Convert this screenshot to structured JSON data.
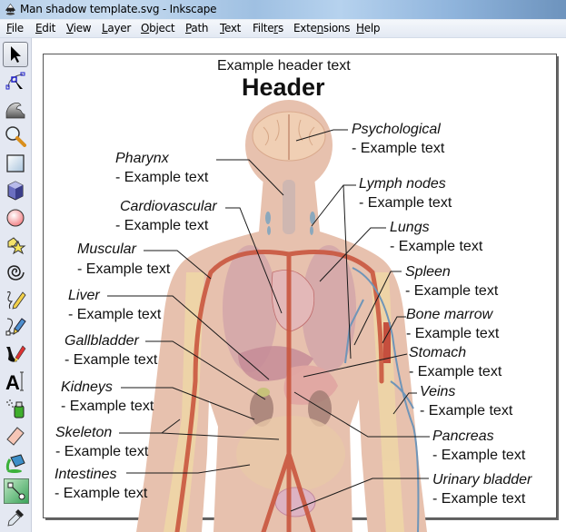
{
  "window": {
    "title": "Man shadow template.svg - Inkscape",
    "app_icon": "inkscape-logo-icon"
  },
  "menubar": {
    "items": [
      {
        "label": "File",
        "mnemonic": "F"
      },
      {
        "label": "Edit",
        "mnemonic": "E"
      },
      {
        "label": "View",
        "mnemonic": "V"
      },
      {
        "label": "Layer",
        "mnemonic": "L"
      },
      {
        "label": "Object",
        "mnemonic": "O"
      },
      {
        "label": "Path",
        "mnemonic": "P"
      },
      {
        "label": "Text",
        "mnemonic": "T"
      },
      {
        "label": "Filters",
        "mnemonic": "r"
      },
      {
        "label": "Extensions",
        "mnemonic": "n"
      },
      {
        "label": "Help",
        "mnemonic": "H"
      }
    ]
  },
  "toolbox": {
    "tools": [
      {
        "name": "selector-tool",
        "icon": "arrow-pointer-icon",
        "active": true
      },
      {
        "name": "node-tool",
        "icon": "node-edit-icon",
        "active": false
      },
      {
        "name": "tweak-tool",
        "icon": "tweak-wave-icon",
        "active": false
      },
      {
        "name": "zoom-tool",
        "icon": "magnifier-icon",
        "active": false
      },
      {
        "name": "rectangle-tool",
        "icon": "rectangle-icon",
        "active": false
      },
      {
        "name": "3d-box-tool",
        "icon": "cube-icon",
        "active": false
      },
      {
        "name": "ellipse-tool",
        "icon": "circle-icon",
        "active": false
      },
      {
        "name": "star-tool",
        "icon": "star-icon",
        "active": false
      },
      {
        "name": "spiral-tool",
        "icon": "spiral-icon",
        "active": false
      },
      {
        "name": "pencil-tool",
        "icon": "pencil-icon",
        "active": false
      },
      {
        "name": "pen-tool",
        "icon": "bezier-pen-icon",
        "active": false
      },
      {
        "name": "calligraphy-tool",
        "icon": "calligraphy-nib-icon",
        "active": false
      },
      {
        "name": "text-tool",
        "icon": "text-a-icon",
        "active": false
      },
      {
        "name": "spray-tool",
        "icon": "spray-can-icon",
        "active": false
      },
      {
        "name": "eraser-tool",
        "icon": "eraser-icon",
        "active": false
      },
      {
        "name": "paint-bucket-tool",
        "icon": "paint-bucket-icon",
        "active": false
      },
      {
        "name": "connector-tool",
        "icon": "connector-icon",
        "active": false
      },
      {
        "name": "dropper-tool",
        "icon": "eyedropper-icon",
        "active": false
      }
    ]
  },
  "document": {
    "header_subtitle": "Example header text",
    "header_title": "Header",
    "labels": [
      {
        "id": "psychological",
        "title": "Psychological",
        "text": "- Example text"
      },
      {
        "id": "pharynx",
        "title": "Pharynx",
        "text": "- Example text"
      },
      {
        "id": "lymph-nodes",
        "title": "Lymph nodes",
        "text": "- Example text"
      },
      {
        "id": "cardiovascular",
        "title": "Cardiovascular",
        "text": "- Example text"
      },
      {
        "id": "lungs",
        "title": "Lungs",
        "text": "- Example text"
      },
      {
        "id": "muscular",
        "title": "Muscular",
        "text": "- Example text"
      },
      {
        "id": "spleen",
        "title": "Spleen",
        "text": "- Example text"
      },
      {
        "id": "liver",
        "title": "Liver",
        "text": "- Example text"
      },
      {
        "id": "bone-marrow",
        "title": "Bone marrow",
        "text": "- Example text"
      },
      {
        "id": "gallbladder",
        "title": "Gallbladder",
        "text": "- Example text"
      },
      {
        "id": "stomach",
        "title": "Stomach",
        "text": "- Example text"
      },
      {
        "id": "kidneys",
        "title": "Kidneys",
        "text": "- Example text"
      },
      {
        "id": "veins",
        "title": "Veins",
        "text": "- Example text"
      },
      {
        "id": "skeleton",
        "title": "Skeleton",
        "text": "- Example text"
      },
      {
        "id": "pancreas",
        "title": "Pancreas",
        "text": "- Example text"
      },
      {
        "id": "intestines",
        "title": "Intestines",
        "text": "- Example text"
      },
      {
        "id": "urinary-bladder",
        "title": "Urinary bladder",
        "text": "- Example text"
      }
    ]
  },
  "colors": {
    "skin": "#e2b9a3",
    "artery": "#c9563f",
    "vein": "#6f95b8",
    "bone": "#f0d9a0",
    "toolbox_bg": "#e4e8f2"
  }
}
